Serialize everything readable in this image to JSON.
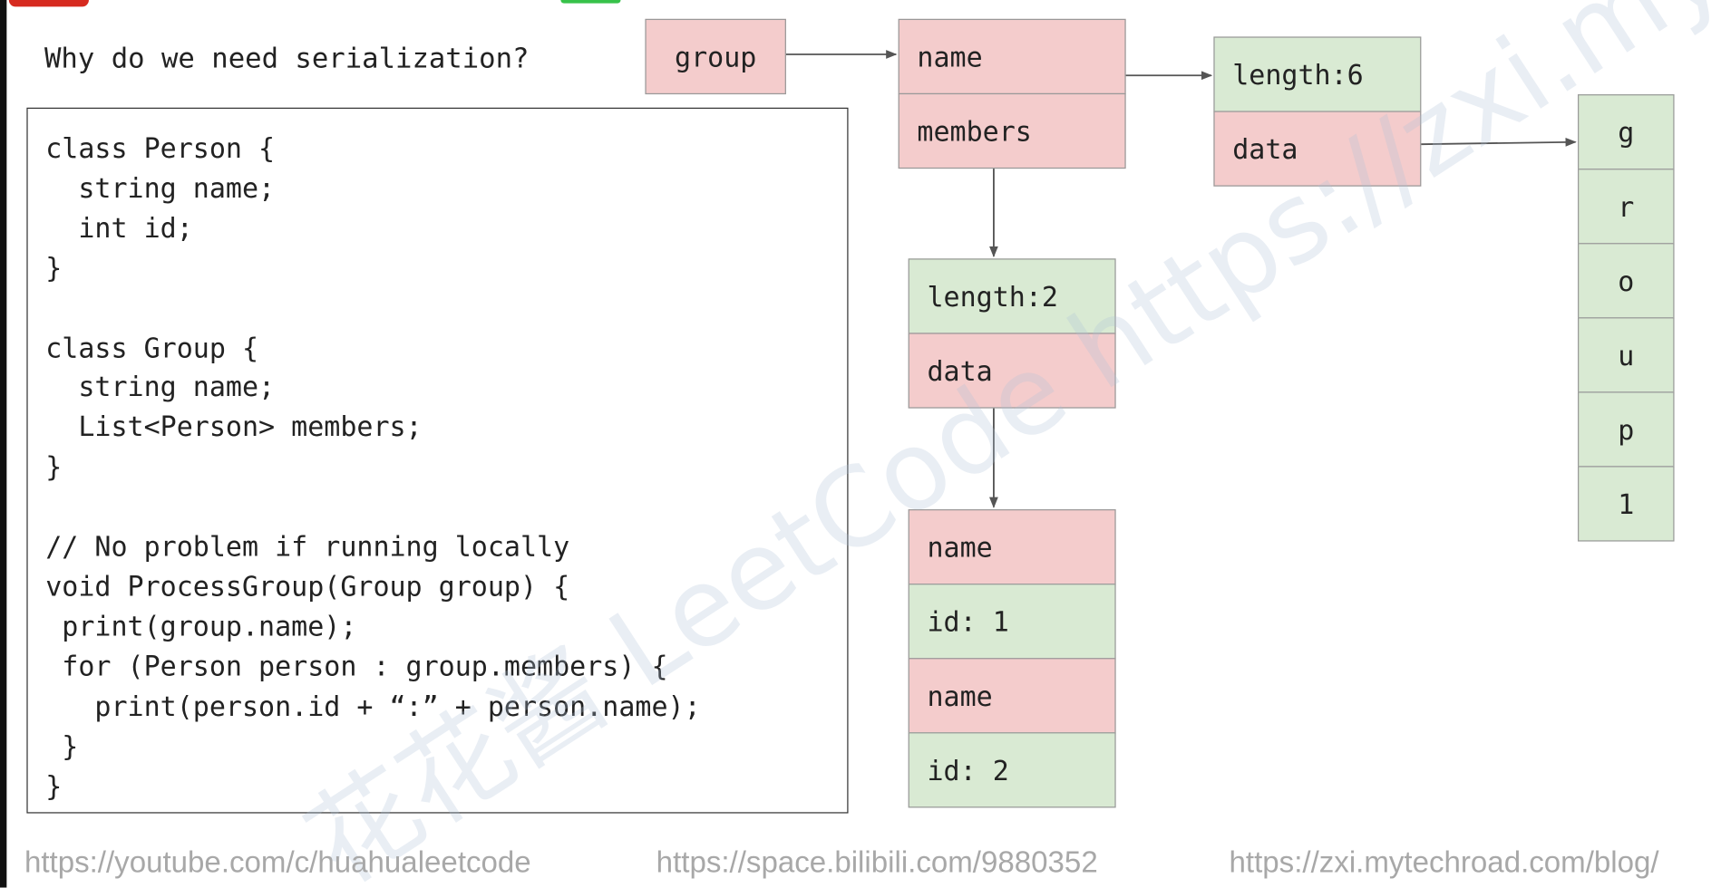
{
  "question": "Why do we need serialization?",
  "code_lines": [
    "class Person {",
    "  string name;",
    "  int id;",
    "}",
    "",
    "class Group {",
    "  string name;",
    "  List<Person> members;",
    "}",
    "",
    "// No problem if running locally",
    "void ProcessGroup(Group group) {",
    " print(group.name);",
    " for (Person person : group.members) {",
    "   print(person.id + “:” + person.name);",
    " }",
    "}"
  ],
  "diagram": {
    "group": "group",
    "group_struct": {
      "name": "name",
      "members": "members"
    },
    "name_string": {
      "length": "length:6",
      "data": "data"
    },
    "name_chars": [
      "g",
      "r",
      "o",
      "u",
      "p",
      "1"
    ],
    "members_list": {
      "length": "length:2",
      "data": "data"
    },
    "person_items": [
      "name",
      "id: 1",
      "name",
      "id: 2"
    ]
  },
  "watermark": "花花酱 LeetCode https://zxi.mytechroad.com/blog/",
  "footer_links": [
    "https://youtube.com/c/huahualeetcode",
    "https://space.bilibili.com/9880352",
    "https://zxi.mytechroad.com/blog/"
  ],
  "colors": {
    "pointer": "#f4cccc",
    "value": "#d9ead3",
    "border": "#999999"
  }
}
